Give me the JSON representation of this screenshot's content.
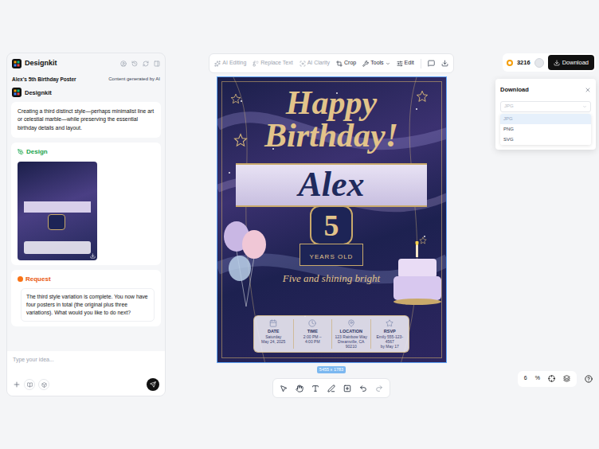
{
  "app": {
    "name": "Designkit"
  },
  "project": {
    "title": "Alex's 5th Birthday Poster",
    "note": "Content generated by AI"
  },
  "assistant": {
    "name": "Designkit"
  },
  "messages": [
    {
      "kind": "text",
      "text": "Creating a third distinct style—perhaps minimalist line art or celestial marble—while preserving the essential birthday details and layout."
    },
    {
      "kind": "design",
      "title": "Design"
    },
    {
      "kind": "request",
      "title": "Request",
      "text": "The third style variation is complete. You now have four posters in total (the original plus three variations). What would you like to do next?"
    }
  ],
  "chat_input": {
    "placeholder": "Type your idea..."
  },
  "toolbar": [
    {
      "label": "AI Editing",
      "disabled": true
    },
    {
      "label": "Replace Text",
      "disabled": true
    },
    {
      "label": "AI Clarity",
      "disabled": true
    },
    {
      "label": "Crop",
      "disabled": false
    },
    {
      "label": "Tools",
      "disabled": false
    },
    {
      "label": "Edit",
      "disabled": false
    }
  ],
  "credits": "3216",
  "download_button": "Download",
  "download_panel": {
    "title": "Download",
    "format": "JPG",
    "options": [
      {
        "label": "JPG",
        "selected": true
      },
      {
        "label": "PNG",
        "selected": false
      },
      {
        "label": "SVG",
        "selected": false
      }
    ]
  },
  "poster": {
    "title": "Happy Birthday!",
    "name": "Alex",
    "age": "5",
    "age_label": "YEARS OLD",
    "tagline": "Five and shining bright",
    "info": [
      {
        "label": "DATE",
        "lines": [
          "Saturday",
          "May 24, 2025"
        ]
      },
      {
        "label": "TIME",
        "lines": [
          "2:00 PM –",
          "4:00 PM"
        ]
      },
      {
        "label": "LOCATION",
        "lines": [
          "123 Rainbow Way",
          "Dreamville, CA 90210"
        ]
      },
      {
        "label": "RSVP",
        "lines": [
          "Emily 555-123-4567",
          "by May 17"
        ]
      }
    ]
  },
  "canvas_size": "5455 x 1783",
  "zoom": "6",
  "zoom_unit": "%"
}
